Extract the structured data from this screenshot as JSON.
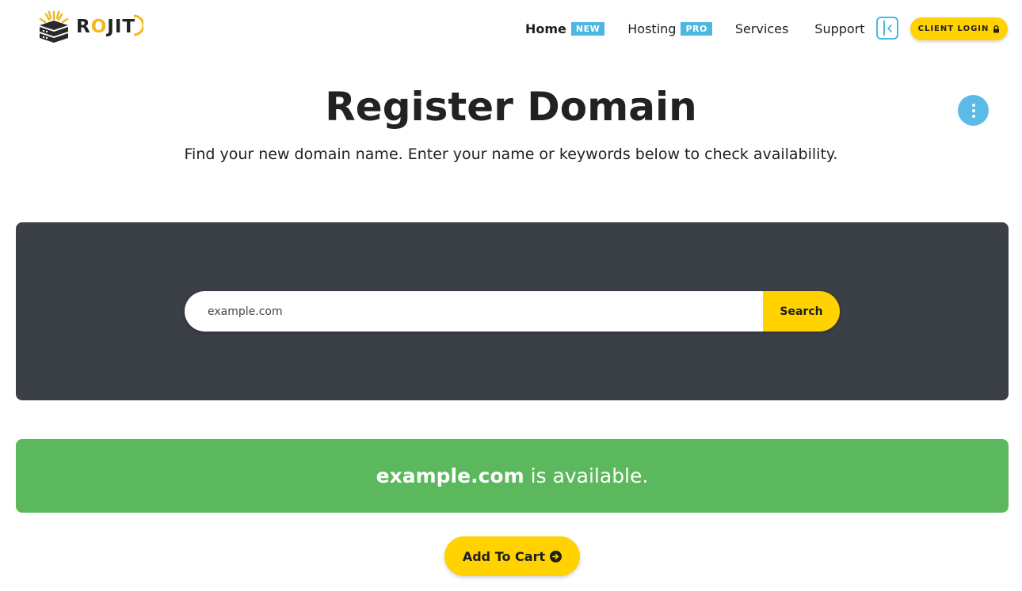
{
  "header": {
    "logo_text": "ROJIT",
    "nav": [
      {
        "label": "Home",
        "badge": "NEW"
      },
      {
        "label": "Hosting",
        "badge": "PRO"
      },
      {
        "label": "Services"
      },
      {
        "label": "Support"
      }
    ],
    "login_label": "CLIENT LOGIN"
  },
  "page": {
    "title": "Register Domain",
    "subtitle": "Find your new domain name. Enter your name or keywords below to check availability."
  },
  "search": {
    "value": "example.com",
    "button_label": "Search"
  },
  "result": {
    "domain": "example.com",
    "status_text": "is available."
  },
  "cart": {
    "button_label": "Add To Cart"
  },
  "colors": {
    "accent": "#ffd200",
    "info": "#4cb8e0",
    "success": "#5cb85c",
    "panel": "#3b3f46"
  },
  "icons": {
    "logo": "server-sun-logo",
    "collapse": "sidebar-collapse-icon",
    "lock": "lock-icon",
    "menu": "vertical-dots-icon",
    "cart_arrow": "arrow-circle-right-icon"
  }
}
